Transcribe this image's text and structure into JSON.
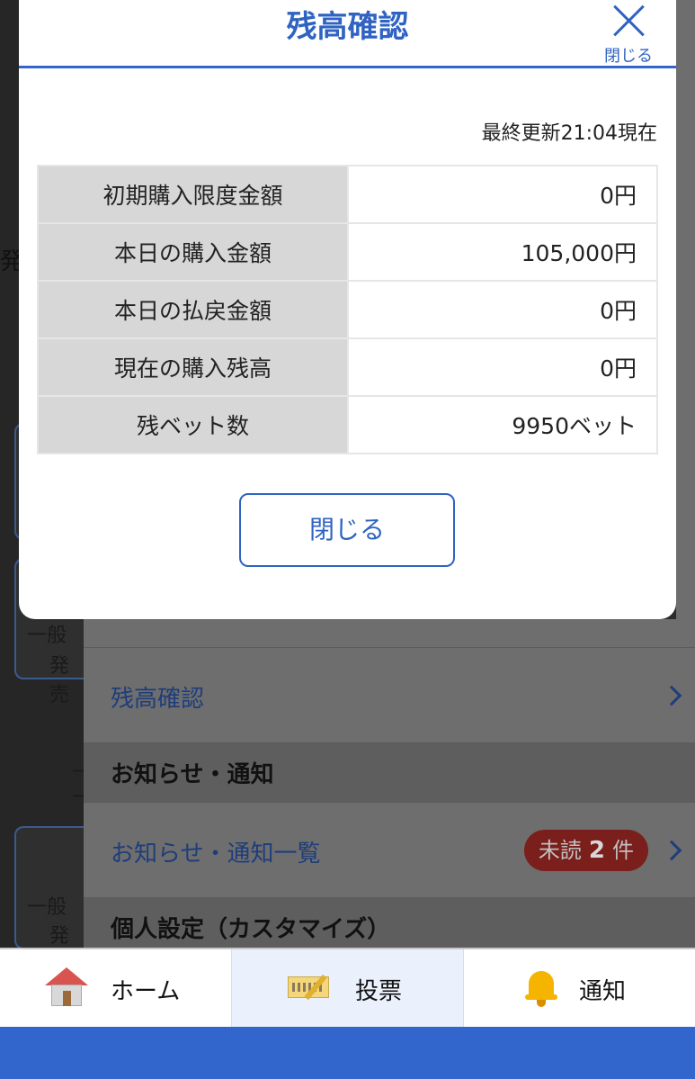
{
  "modal": {
    "title": "残高確認",
    "close_label": "閉じる",
    "updated": "最終更新21:04現在",
    "rows": [
      {
        "label": "初期購入限度金額",
        "value": "0円"
      },
      {
        "label": "本日の購入金額",
        "value": "105,000円"
      },
      {
        "label": "本日の払戻金額",
        "value": "0円"
      },
      {
        "label": "現在の購入残高",
        "value": "0円"
      },
      {
        "label": "残ベット数",
        "value": "9950ベット"
      }
    ],
    "close_button": "閉じる"
  },
  "background": {
    "left_fragments": [
      "発",
      "一般",
      "発売",
      "一",
      "一",
      "一般",
      "発売"
    ],
    "menu": {
      "balance_link": "残高確認",
      "notice_header": "お知らせ・通知",
      "notice_link": "お知らせ・通知一覧",
      "unread_prefix": "未読",
      "unread_count": "2",
      "unread_suffix": "件",
      "personal_header": "個人設定（カスタマイズ）"
    }
  },
  "tabbar": {
    "home": "ホーム",
    "vote": "投票",
    "notify": "通知"
  },
  "colors": {
    "accent": "#3366cc",
    "badge": "#c0392b"
  },
  "icons": [
    "close-icon",
    "home-icon",
    "ballot-icon",
    "bell-icon",
    "chevron-right-icon"
  ]
}
